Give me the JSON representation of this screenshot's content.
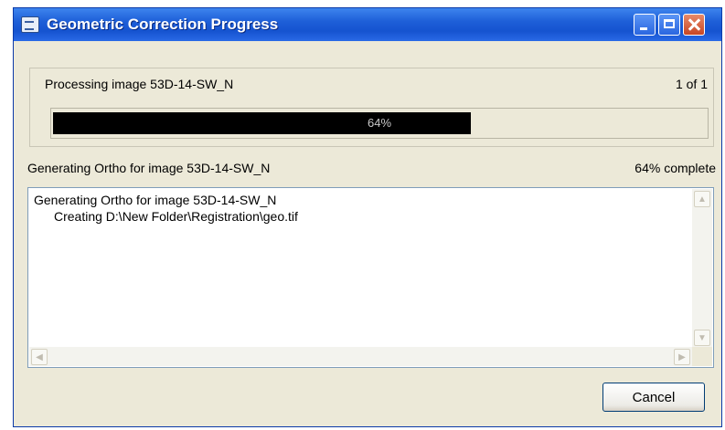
{
  "window": {
    "title": "Geometric Correction Progress"
  },
  "progress_group": {
    "processing_label": "Processing image 53D-14-SW_N",
    "count_label": "1 of 1",
    "progress_value": 0.64,
    "progress_text": "64%"
  },
  "status": {
    "left_text": "Generating Ortho for image 53D-14-SW_N",
    "right_text": "64% complete"
  },
  "log": {
    "lines": [
      "Generating Ortho for image 53D-14-SW_N",
      "Creating D:\\New Folder\\Registration\\geo.tif"
    ]
  },
  "buttons": {
    "cancel_label": "Cancel"
  },
  "colors": {
    "titlebar": "#1e5fd8",
    "progress_fill": "#000000",
    "window_bg": "#ece9d8"
  }
}
